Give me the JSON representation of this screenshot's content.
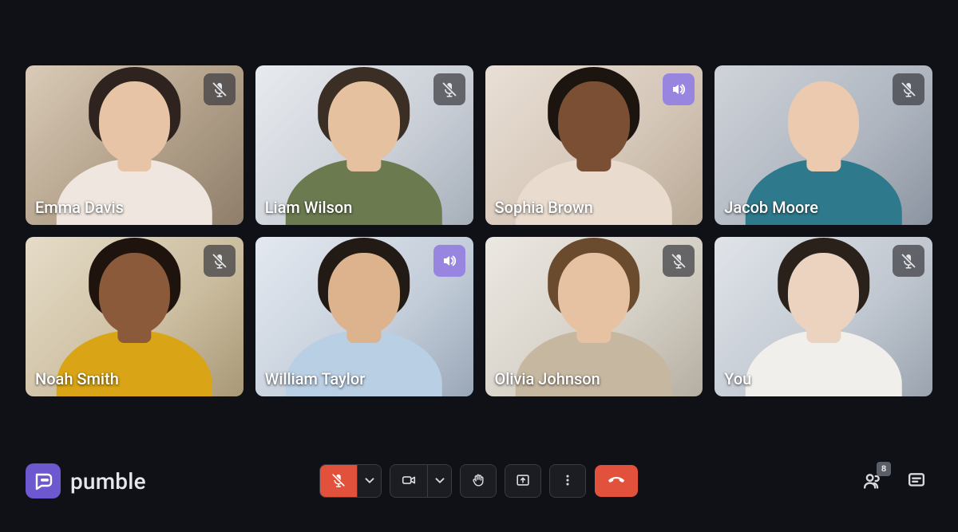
{
  "brand": {
    "name": "pumble"
  },
  "participants": [
    {
      "name": "Emma Davis",
      "status": "muted",
      "speaking": false
    },
    {
      "name": "Liam Wilson",
      "status": "muted",
      "speaking": false
    },
    {
      "name": "Sophia Brown",
      "status": "speaking",
      "speaking": true
    },
    {
      "name": "Jacob Moore",
      "status": "muted",
      "speaking": false
    },
    {
      "name": "Noah Smith",
      "status": "muted",
      "speaking": false
    },
    {
      "name": "William Taylor",
      "status": "speaking",
      "speaking": true
    },
    {
      "name": "Olivia Johnson",
      "status": "muted",
      "speaking": false
    },
    {
      "name": "You",
      "status": "muted",
      "speaking": false
    }
  ],
  "controls": {
    "mic_icon": "mic-off-icon",
    "camera_icon": "video-icon",
    "raise_hand_icon": "raise-hand-icon",
    "share_icon": "screen-share-icon",
    "more_icon": "more-options-icon",
    "hangup_icon": "hang-up-icon",
    "participants_icon": "participants-icon",
    "chat_icon": "chat-icon"
  },
  "participant_count_badge": "8",
  "colors": {
    "bg": "#0f1116",
    "accent": "#6e58cf",
    "danger": "#e2513b"
  }
}
